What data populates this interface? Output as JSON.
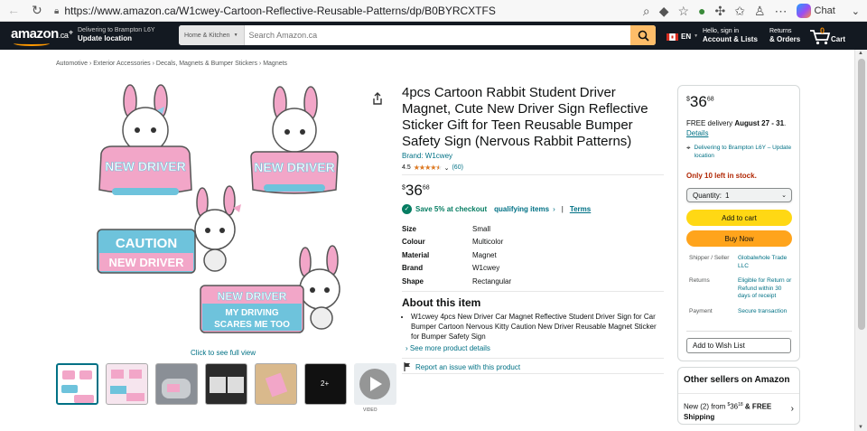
{
  "browser": {
    "url": "https://www.amazon.ca/W1cwey-Cartoon-Reflective-Reusable-Patterns/dp/B0BYRCXTFS",
    "chat_label": "Chat"
  },
  "nav": {
    "logo": "amazon",
    "logo_suffix": ".ca",
    "deliver_line1": "Delivering to Brampton L6Y",
    "deliver_line2": "Update location",
    "search_department": "Home & Kitchen",
    "search_placeholder": "Search Amazon.ca",
    "language": "EN",
    "account_line1": "Hello, sign in",
    "account_line2": "Account & Lists",
    "returns_line1": "Returns",
    "returns_line2": "& Orders",
    "cart_count": "0",
    "cart_label": "Cart"
  },
  "breadcrumbs": [
    "Automotive",
    "Exterior Accessories",
    "Decals, Magnets & Bumper Stickers",
    "Magnets"
  ],
  "gallery": {
    "sign1": "NEW DRIVER",
    "sign2": "NEW DRIVER",
    "sign3_line1": "CAUTION",
    "sign3_line2": "NEW DRIVER",
    "sign4_line1": "NEW DRIVER",
    "sign4_line2": "MY DRIVING",
    "sign4_line3": "SCARES ME TOO",
    "full_view": "Click to see full view",
    "more_count": "2+",
    "video_label": "VIDEO"
  },
  "product": {
    "title": "4pcs Cartoon Rabbit Student Driver Magnet, Cute New Driver Sign Reflective Sticker Gift for Teen Reusable Bumper Safety Sign (Nervous Rabbit Patterns)",
    "brand": "Brand: W1cwey",
    "rating": "4.5",
    "rating_fill": 0.9,
    "reviews": "(60)",
    "price_symbol": "$",
    "price_whole": "36",
    "price_fraction": "68",
    "save_text": "Save 5% at checkout",
    "save_link": "qualifying items",
    "terms": "Terms",
    "specs": [
      {
        "k": "Size",
        "v": "Small"
      },
      {
        "k": "Colour",
        "v": "Multicolor"
      },
      {
        "k": "Material",
        "v": "Magnet"
      },
      {
        "k": "Brand",
        "v": "W1cwey"
      },
      {
        "k": "Shape",
        "v": "Rectangular"
      }
    ],
    "about_title": "About this item",
    "bullet": "W1cwey 4pcs New Driver Car Magnet Reflective Student Driver Sign for Car Bumper Cartoon Nervous Kitty Caution New Driver Reusable Magnet Sticker for Bumper Safety Sign",
    "see_more": "See more product details",
    "report": "Report an issue with this product"
  },
  "buybox": {
    "price_symbol": "$",
    "price_whole": "36",
    "price_fraction": "68",
    "delivery_prefix": "FREE delivery ",
    "delivery_dates": "August 27 - 31",
    "delivery_suffix": ".",
    "details": "Details",
    "location": "Delivering to Brampton L6Y – Update location",
    "stock": "Only 10 left in stock.",
    "quantity_label": "Quantity:",
    "quantity_value": "1",
    "add_to_cart": "Add to cart",
    "buy_now": "Buy Now",
    "rows": [
      {
        "k": "Shipper / Seller",
        "v": "Globalwhole Trade LLC"
      },
      {
        "k": "Returns",
        "v": "Eligible for Return or Refund within 30 days of receipt"
      },
      {
        "k": "Payment",
        "v": "Secure transaction"
      }
    ],
    "wishlist": "Add to Wish List"
  },
  "other_sellers": {
    "heading": "Other sellers on Amazon",
    "new_prefix": "New (2) from ",
    "price_symbol": "$",
    "price_whole": "36",
    "price_fraction": "18",
    "free": " & FREE",
    "shipping": "Shipping"
  },
  "colors": {
    "nav_bg": "#131921",
    "search_btn": "#febd69",
    "link": "#007185",
    "add_cart": "#ffd814",
    "buy_now": "#ffa41c",
    "stock_red": "#b12704",
    "sign_pink": "#f2a6c8",
    "sign_blue": "#6ec3dc"
  }
}
